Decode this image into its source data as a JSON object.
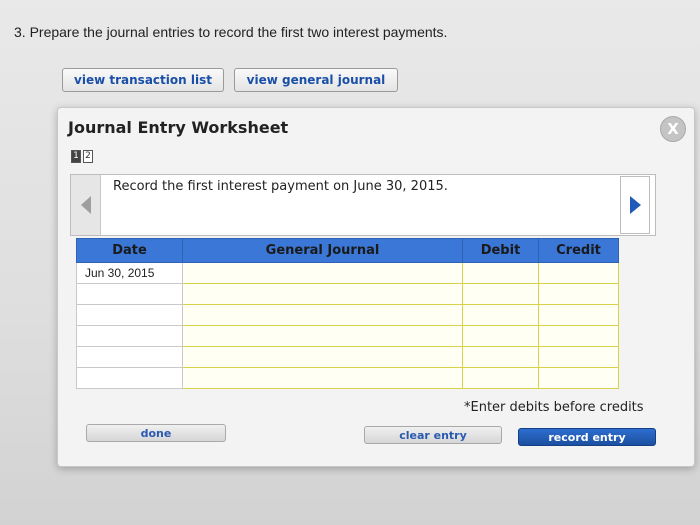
{
  "question": "3. Prepare the journal entries to record the first two interest payments.",
  "top_buttons": {
    "transaction_list": "view transaction list",
    "general_journal": "view general journal"
  },
  "worksheet": {
    "title": "Journal Entry Worksheet",
    "close_label": "X",
    "pages": [
      "1",
      "2"
    ],
    "active_page": 1,
    "instruction": "Record the first interest payment on June 30, 2015.",
    "table": {
      "headers": [
        "Date",
        "General Journal",
        "Debit",
        "Credit"
      ],
      "rows": [
        {
          "date": "Jun 30, 2015"
        },
        {
          "date": ""
        },
        {
          "date": ""
        },
        {
          "date": ""
        },
        {
          "date": ""
        },
        {
          "date": ""
        }
      ]
    },
    "hint": "*Enter debits before credits",
    "buttons": {
      "done": "done",
      "clear": "clear entry",
      "record": "record entry"
    }
  },
  "colors": {
    "header_blue": "#3a77d6",
    "record_button": "#1b4fa0",
    "link_blue": "#1a4fa8"
  }
}
